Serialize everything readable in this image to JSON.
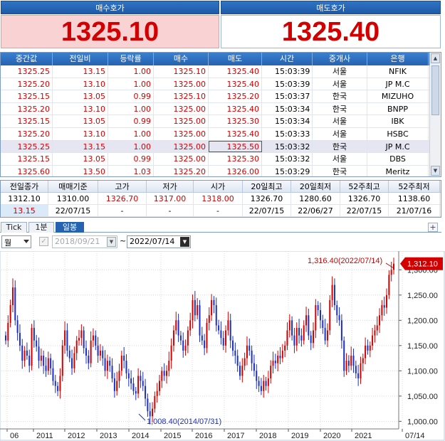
{
  "quote": {
    "bid_title": "매수호가",
    "ask_title": "매도호가",
    "bid_value": "1325.10",
    "ask_value": "1325.40"
  },
  "quote_table": {
    "headers": [
      "중간값",
      "전일비",
      "등락률",
      "매수",
      "매도",
      "시간",
      "중개사",
      "은행"
    ],
    "rows": [
      [
        "1325.25",
        "13.15",
        "1.00",
        "1325.10",
        "1325.40",
        "15:03:39",
        "서울",
        "NFIK"
      ],
      [
        "1325.20",
        "13.10",
        "1.00",
        "1325.00",
        "1325.40",
        "15:03:39",
        "서울",
        "JP M.C"
      ],
      [
        "1325.15",
        "13.05",
        "0.99",
        "1325.10",
        "1325.20",
        "15:03:37",
        "한국",
        "MIZUHO"
      ],
      [
        "1325.20",
        "13.10",
        "1.00",
        "1325.00",
        "1325.40",
        "15:03:34",
        "한국",
        "BNPP"
      ],
      [
        "1325.15",
        "13.05",
        "0.99",
        "1325.00",
        "1325.30",
        "15:03:34",
        "서울",
        "IBK"
      ],
      [
        "1325.20",
        "13.10",
        "1.00",
        "1325.00",
        "1325.40",
        "15:03:33",
        "서울",
        "HSBC"
      ],
      [
        "1325.25",
        "13.15",
        "1.00",
        "1325.00",
        "1325.50",
        "15:03:32",
        "한국",
        "JP M.C"
      ],
      [
        "1325.15",
        "13.05",
        "0.99",
        "1325.00",
        "1325.30",
        "15:03:32",
        "서울",
        "DBS"
      ],
      [
        "1325.60",
        "13.50",
        "1.03",
        "1325.20",
        "1326.00",
        "15:03:29",
        "한국",
        "Meritz"
      ]
    ]
  },
  "summary": {
    "headers": [
      "전일종가",
      "매매기준",
      "고가",
      "저가",
      "시가",
      "20일최고",
      "20일최저",
      "52주최고",
      "52주최저"
    ],
    "row1": [
      "1312.10",
      "1310.00",
      "1326.70",
      "1317.00",
      "1318.00",
      "1326.70",
      "1280.60",
      "1326.70",
      "1138.60"
    ],
    "row2": [
      "13.15",
      "22/07/15",
      "-",
      "-",
      "-",
      "22/07/15",
      "22/06/27",
      "22/07/15",
      "21/07/16"
    ]
  },
  "tabs": [
    "Tick",
    "1분",
    "일봉"
  ],
  "toolbar": {
    "period": "월",
    "date_from": "2018/09/21",
    "tilde": "~",
    "date_to": "2022/07/14"
  },
  "chart_data": {
    "type": "candlestick",
    "x_labels": [
      "06",
      "2011",
      "2012",
      "2013",
      "2014",
      "2015",
      "2016",
      "2017",
      "2018",
      "2019",
      "2020",
      "2021",
      "07/14"
    ],
    "y_ticks": [
      "1,300.00",
      "1,250.00",
      "1,200.00",
      "1,150.00",
      "1,100.00",
      "1,050.00",
      "1,000.00"
    ],
    "ylim": [
      985,
      1330
    ],
    "current_value": "1,312.10",
    "high_annotation": "1,316.40(2022/07/14)",
    "low_annotation": "1,008.40(2014/07/31)",
    "colors": {
      "up": "#d20000",
      "down": "#1b2fc8",
      "current_tag": "#d20000"
    },
    "monthly_closes": [
      1160,
      1195,
      1230,
      1265,
      1200,
      1175,
      1150,
      1120,
      1140,
      1130,
      1110,
      1185,
      1160,
      1148,
      1120,
      1130,
      1110,
      1100,
      1125,
      1105,
      1080,
      1070,
      1060,
      1090,
      1150,
      1180,
      1140,
      1125,
      1105,
      1135,
      1160,
      1165,
      1180,
      1145,
      1130,
      1115,
      1160,
      1170,
      1150,
      1130,
      1140,
      1125,
      1100,
      1120,
      1110,
      1085,
      1060,
      1080,
      1100,
      1130,
      1120,
      1095,
      1085,
      1075,
      1060,
      1055,
      1090,
      1080,
      1070,
      1045,
      1020,
      1010,
      1025,
      1050,
      1060,
      1080,
      1100,
      1090,
      1100,
      1120,
      1150,
      1180,
      1200,
      1170,
      1160,
      1140,
      1150,
      1180,
      1200,
      1240,
      1210,
      1230,
      1170,
      1160,
      1145,
      1195,
      1210,
      1240,
      1230,
      1190,
      1180,
      1165,
      1150,
      1180,
      1200,
      1160,
      1140,
      1130,
      1110,
      1090,
      1110,
      1125,
      1150,
      1140,
      1115,
      1100,
      1080,
      1070,
      1060,
      1080,
      1070,
      1085,
      1110,
      1120,
      1115,
      1130,
      1125,
      1140,
      1150,
      1180,
      1200,
      1170,
      1150,
      1185,
      1170,
      1160,
      1190,
      1210,
      1170,
      1155,
      1180,
      1230,
      1220,
      1200,
      1185,
      1160,
      1180,
      1240,
      1270,
      1230,
      1210,
      1200,
      1160,
      1100,
      1120,
      1110,
      1130,
      1110,
      1095,
      1085,
      1115,
      1125,
      1150,
      1140,
      1150,
      1170,
      1180,
      1190,
      1210,
      1230,
      1225,
      1250,
      1290,
      1300,
      1312
    ]
  }
}
